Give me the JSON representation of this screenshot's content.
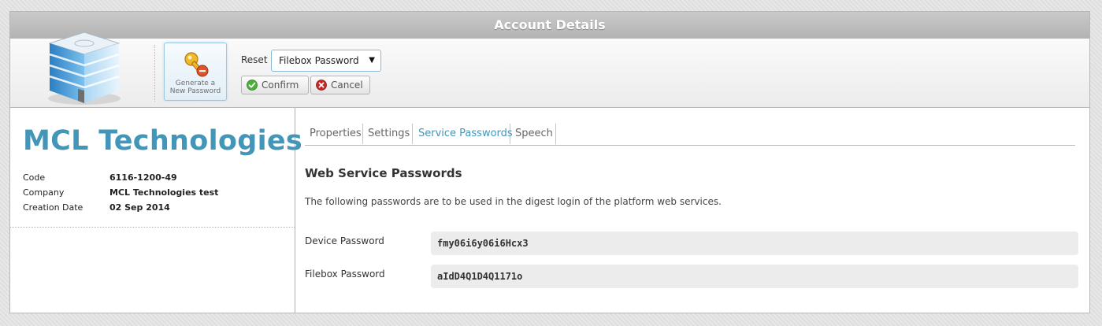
{
  "window": {
    "title": "Account Details"
  },
  "toolbar": {
    "generate_label": "Generate a\nNew Password",
    "reset_label": "Reset",
    "reset_select": {
      "selected": "Filebox Password"
    },
    "confirm_label": "Confirm",
    "cancel_label": "Cancel"
  },
  "company": {
    "name": "MCL Technologies",
    "fields": [
      {
        "label": "Code",
        "value": "6116-1200-49"
      },
      {
        "label": "Company",
        "value": "MCL Technologies test"
      },
      {
        "label": "Creation Date",
        "value": "02 Sep 2014"
      }
    ]
  },
  "tabs": [
    {
      "label": "Properties",
      "active": false
    },
    {
      "label": "Settings",
      "active": false
    },
    {
      "label": "Service Passwords",
      "active": true
    },
    {
      "label": "Speech",
      "active": false
    }
  ],
  "service_passwords": {
    "title": "Web Service Passwords",
    "description": "The following passwords are to be used in the digest login of the platform web services.",
    "rows": [
      {
        "label": "Device Password",
        "value": "fmy06i6y06i6Hcx3"
      },
      {
        "label": "Filebox Password",
        "value": "aIdD4Q1D4Q1171o"
      }
    ]
  },
  "colors": {
    "accent": "#4396b8",
    "titlebar": "#bdbdbd",
    "confirm_icon": "#4caf3a",
    "cancel_icon": "#c62828"
  },
  "icons": {
    "logo": "building-icon",
    "generate": "key-icon",
    "confirm": "check-icon",
    "cancel": "close-icon",
    "dropdown": "chevron-down-icon"
  }
}
